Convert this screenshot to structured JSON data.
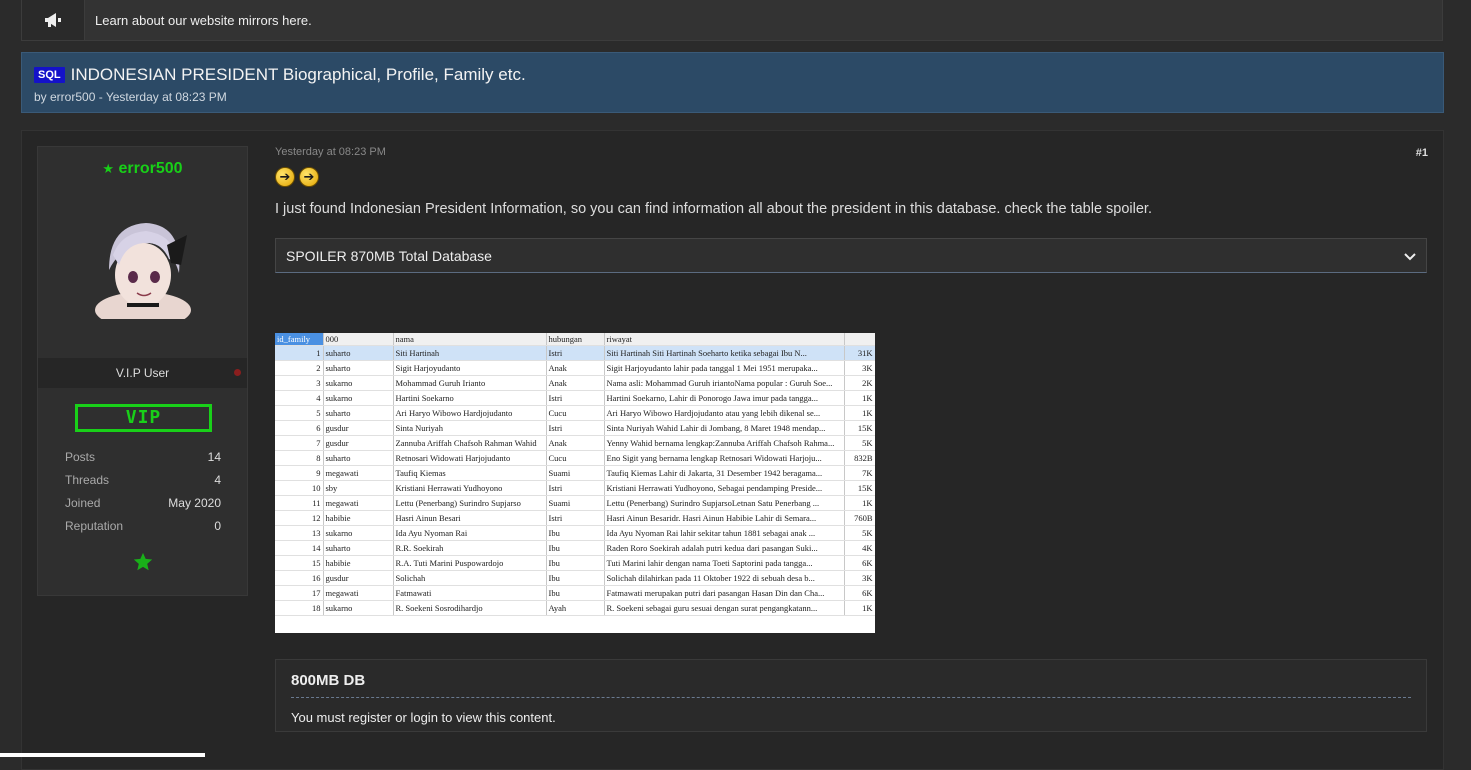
{
  "notice": {
    "text": "Learn about our website mirrors here.",
    "icon": "megaphone-icon"
  },
  "thread": {
    "prefix": "SQL",
    "title": "INDONESIAN PRESIDENT Biographical, Profile, Family etc.",
    "meta": "by error500 - Yesterday at 08:23 PM"
  },
  "user": {
    "name": "error500",
    "title": "V.I.P User",
    "badge": "VIP",
    "stats": [
      {
        "label": "Posts",
        "value": "14"
      },
      {
        "label": "Threads",
        "value": "4"
      },
      {
        "label": "Joined",
        "value": "May 2020"
      },
      {
        "label": "Reputation",
        "value": "0"
      }
    ],
    "colors": {
      "name": "#18d018",
      "badge": "#19d019"
    }
  },
  "post": {
    "date": "Yesterday at 08:23 PM",
    "number": "#1",
    "text": "I just found Indonesian President Information, so you can find information all about the president in this database. check the table spoiler.",
    "spoiler_label": "SPOILER 870MB Total Database"
  },
  "db_table": {
    "headers": [
      "id_family",
      "000",
      "nama",
      "hubungan",
      "riwayat",
      ""
    ],
    "rows": [
      [
        "1",
        "suharto",
        "Siti Hartinah",
        "Istri",
        "Siti Hartinah Siti Hartinah Soeharto ketika sebagai Ibu N...",
        "31K"
      ],
      [
        "2",
        "suharto",
        "Sigit Harjoyudanto",
        "Anak",
        "Sigit Harjoyudanto lahir pada tanggal 1 Mei 1951 merupaka...",
        "3K"
      ],
      [
        "3",
        "sukarno",
        "Mohammad Guruh Irianto",
        "Anak",
        "Nama asli: Mohammad Guruh iriantoNama popular : Guruh Soe...",
        "2K"
      ],
      [
        "4",
        "sukarno",
        "Hartini Soekarno",
        "Istri",
        "Hartini Soekarno, Lahir di Ponorogo Jawa imur pada tangga...",
        "1K"
      ],
      [
        "5",
        "suharto",
        "Ari Haryo Wibowo Hardjojudanto",
        "Cucu",
        "Ari Haryo Wibowo Hardjojudanto atau yang lebih dikenal se...",
        "1K"
      ],
      [
        "6",
        "gusdur",
        "Sinta Nuriyah",
        "Istri",
        "Sinta Nuriyah Wahid Lahir di Jombang, 8 Maret 1948 mendap...",
        "15K"
      ],
      [
        "7",
        "gusdur",
        "Zannuba Ariffah Chafsoh Rahman Wahid",
        "Anak",
        "Yenny Wahid bernama lengkap:Zannuba Ariffah Chafsoh Rahma...",
        "5K"
      ],
      [
        "8",
        "suharto",
        "Retnosari Widowati Harjojudanto",
        "Cucu",
        "Eno Sigit yang bernama lengkap Retnosari Widowati Harjoju...",
        "832B"
      ],
      [
        "9",
        "megawati",
        "Taufiq Kiemas",
        "Suami",
        "Taufiq Kiemas Lahir di Jakarta, 31 Desember 1942 beragama...",
        "7K"
      ],
      [
        "10",
        "sby",
        "Kristiani Herrawati Yudhoyono",
        "Istri",
        "Kristiani Herrawati Yudhoyono, Sebagai pendamping Preside...",
        "15K"
      ],
      [
        "11",
        "megawati",
        "Lettu (Penerbang) Surindro Supjarso",
        "Suami",
        "Lettu (Penerbang) Surindro SupjarsoLetnan Satu Penerbang ...",
        "1K"
      ],
      [
        "12",
        "habibie",
        "Hasri Ainun Besari",
        "Istri",
        "Hasri Ainun Besaridr. Hasri Ainun Habibie Lahir di Semara...",
        "760B"
      ],
      [
        "13",
        "sukarno",
        "Ida Ayu Nyoman Rai",
        "Ibu",
        "Ida Ayu Nyoman Rai lahir sekitar tahun 1881 sebagai anak ...",
        "5K"
      ],
      [
        "14",
        "suharto",
        "R.R. Soekirah",
        "Ibu",
        "Raden Roro Soekirah adalah putri kedua dari pasangan Suki...",
        "4K"
      ],
      [
        "15",
        "habibie",
        "R.A. Tuti Marini Puspowardojo",
        "Ibu",
        "Tuti Marini lahir dengan nama Toeti Saptorini pada tangga...",
        "6K"
      ],
      [
        "16",
        "gusdur",
        "Solichah",
        "Ibu",
        "Solichah dilahirkan pada 11 Oktober 1922 di sebuah desa b...",
        "3K"
      ],
      [
        "17",
        "megawati",
        "Fatmawati",
        "Ibu",
        "Fatmawati merupakan putri dari pasangan Hasan Din dan Cha...",
        "6K"
      ],
      [
        "18",
        "sukarno",
        "R. Soekeni Sosrodihardjo",
        "Ayah",
        "R. Soekeni sebagai guru sesuai dengan surat pengangkatann...",
        "1K"
      ]
    ]
  },
  "locked": {
    "title": "800MB DB",
    "text": "You must register or login to view this content."
  },
  "colors": {
    "header_bg": "#2c4a66",
    "prefix_bg": "#1412c9",
    "accent_green": "#18d018"
  }
}
